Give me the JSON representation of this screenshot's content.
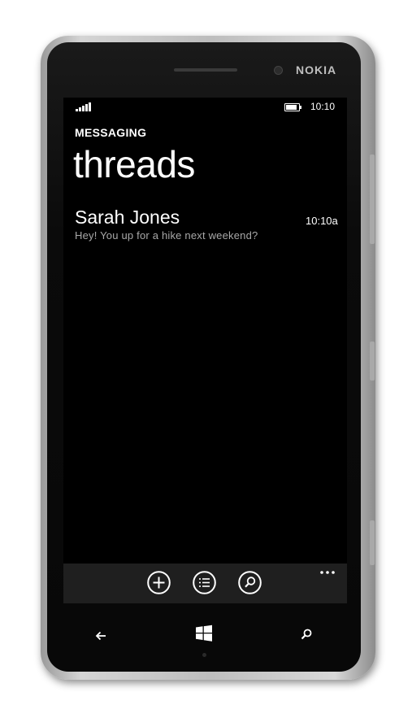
{
  "device": {
    "brand": "NOKIA"
  },
  "status_bar": {
    "signal_bars": 5,
    "battery_level": 0.85,
    "time": "10:10"
  },
  "header": {
    "app_title": "MESSAGING",
    "page_title": "threads"
  },
  "threads": [
    {
      "name": "Sarah Jones",
      "time": "10:10a",
      "preview": "Hey! You up for a hike next weekend?"
    }
  ],
  "app_bar": {
    "buttons": [
      {
        "icon": "add-icon"
      },
      {
        "icon": "select-icon"
      },
      {
        "icon": "search-icon"
      }
    ],
    "more": "..."
  },
  "nav_bar": {
    "buttons": [
      {
        "icon": "back-icon"
      },
      {
        "icon": "windows-start-icon"
      },
      {
        "icon": "search-icon"
      }
    ]
  },
  "colors": {
    "screen_background": "#000000",
    "app_bar_background": "#1f1f1f",
    "text_primary": "#ffffff",
    "text_secondary": "#a8a8a8"
  }
}
